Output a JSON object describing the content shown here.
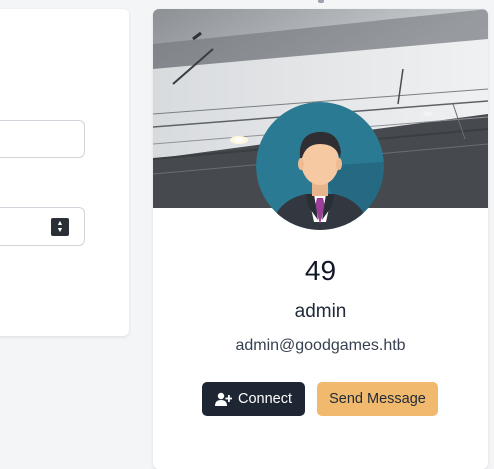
{
  "profile": {
    "user_id": "49",
    "username": "admin",
    "email": "admin@goodgames.htb",
    "connect_label": "Connect",
    "message_label": "Send Message",
    "connect_icon": "user-plus-icon"
  },
  "form": {
    "text_input_value": "",
    "number_input_value": ""
  },
  "colors": {
    "page_background": "#f4f5f7",
    "connect_button": "#1e2633",
    "message_button": "#f0b96e",
    "avatar_background": "#2b7a93"
  }
}
